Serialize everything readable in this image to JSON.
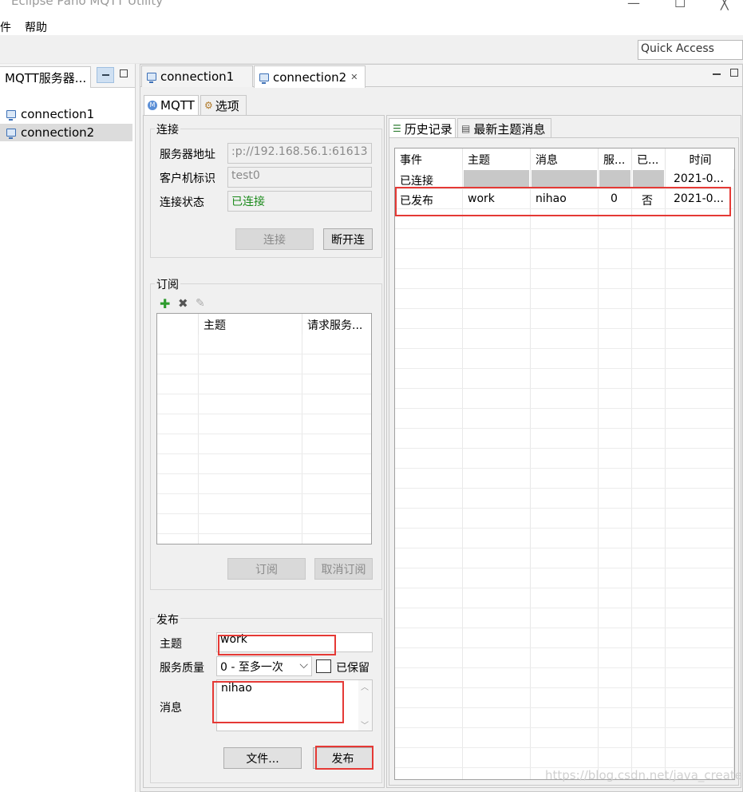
{
  "window": {
    "title": "Eclipse Paho MQTT Utility",
    "minimize": "—",
    "maximize": "☐",
    "close": "╳"
  },
  "menu": {
    "file": "件",
    "help": "帮助"
  },
  "quick_access": "Quick Access",
  "left_panel": {
    "tab": "MQTT服务器...",
    "items": [
      "connection1",
      "connection2"
    ],
    "selected": "connection2"
  },
  "editor_tabs": [
    "connection1",
    "connection2"
  ],
  "sub_tabs": {
    "mqtt": "MQTT",
    "options": "选项"
  },
  "connection": {
    "group": "连接",
    "server_label": "服务器地址",
    "server_value": ":p://192.168.56.1:61613",
    "client_label": "客户机标识",
    "client_value": "test0",
    "status_label": "连接状态",
    "status_value": "已连接",
    "status_color": "#1b8a1b",
    "connect_btn": "连接",
    "disconnect_btn": "断开连"
  },
  "subscribe": {
    "group": "订阅",
    "columns": [
      "主题",
      "请求服务..."
    ],
    "subscribe_btn": "订阅",
    "unsubscribe_btn": "取消订阅"
  },
  "publish": {
    "group": "发布",
    "topic_label": "主题",
    "topic_value": "work",
    "qos_label": "服务质量",
    "qos_value": "0 - 至多一次",
    "retain_label": "已保留",
    "message_label": "消息",
    "message_value": "nihao",
    "file_btn": "文件...",
    "publish_btn": "发布"
  },
  "history": {
    "tab_history": "历史记录",
    "tab_latest": "最新主题消息",
    "columns": [
      "事件",
      "主题",
      "消息",
      "服...",
      "已...",
      "时间"
    ],
    "rows": [
      {
        "event": "已连接",
        "topic": "",
        "message": "",
        "qos": "",
        "retained": "",
        "time": "2021-0..."
      },
      {
        "event": "已发布",
        "topic": "work",
        "message": "nihao",
        "qos": "0",
        "retained": "否",
        "time": "2021-0..."
      }
    ]
  },
  "watermark": "https://blog.csdn.net/java_creater"
}
